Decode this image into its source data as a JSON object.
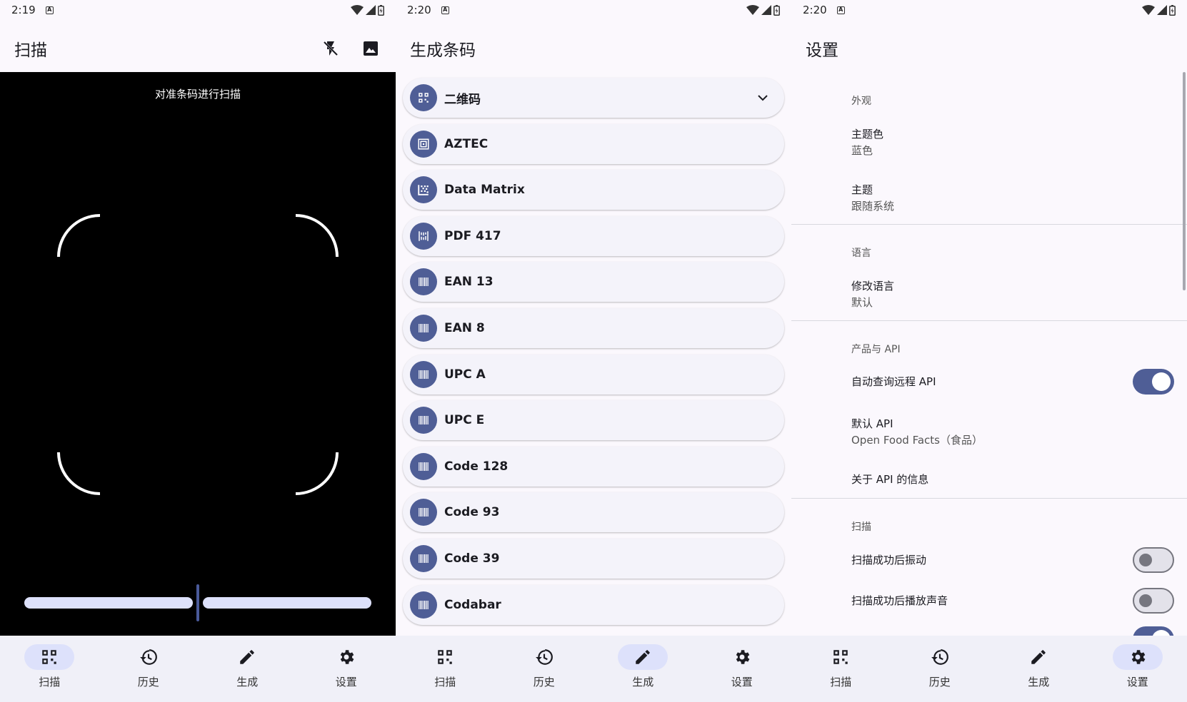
{
  "colors": {
    "accent": "#4f5e96",
    "indicator": "#dde1fb",
    "nav_bg": "#f0f0f8"
  },
  "nav": {
    "scan": "扫描",
    "history": "历史",
    "generate": "生成",
    "settings": "设置"
  },
  "scan_screen": {
    "status_time": "2:19",
    "title": "扫描",
    "hint": "对准条码进行扫描",
    "zoom_level": 0.5,
    "icons": [
      "flash-off-icon",
      "image-icon"
    ]
  },
  "generate_screen": {
    "status_time": "2:20",
    "title": "生成条码",
    "formats": [
      "二维码",
      "AZTEC",
      "Data Matrix",
      "PDF 417",
      "EAN 13",
      "EAN 8",
      "UPC A",
      "UPC E",
      "Code 128",
      "Code 93",
      "Code 39",
      "Codabar"
    ]
  },
  "settings_screen": {
    "status_time": "2:20",
    "title": "设置",
    "appearance": {
      "header": "外观",
      "theme_color_title": "主题色",
      "theme_color_value": "蓝色",
      "theme_title": "主题",
      "theme_value": "跟随系统"
    },
    "language": {
      "header": "语言",
      "change_title": "修改语言",
      "change_value": "默认"
    },
    "api": {
      "header": "产品与 API",
      "auto_query": "自动查询远程 API",
      "auto_query_on": true,
      "default_title": "默认 API",
      "default_value": "Open Food Facts（食品）",
      "about": "关于 API 的信息"
    },
    "scan": {
      "header": "扫描",
      "vibrate": "扫描成功后振动",
      "vibrate_on": false,
      "sound": "扫描成功后播放声音",
      "sound_on": false
    }
  }
}
